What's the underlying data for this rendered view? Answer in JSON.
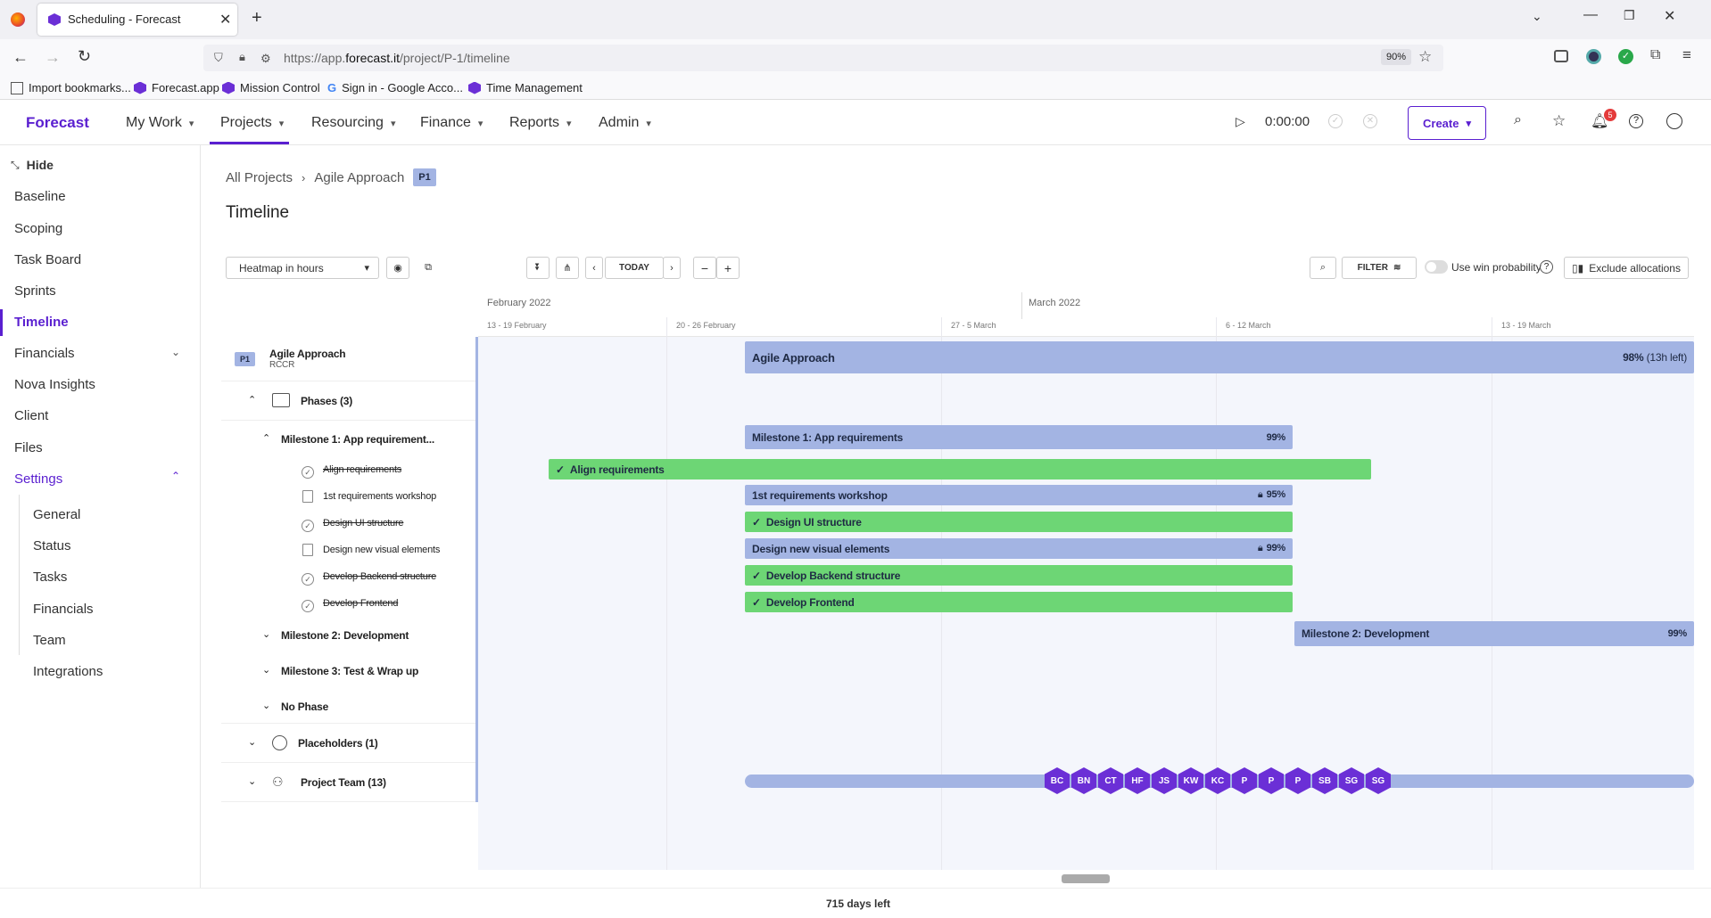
{
  "browser": {
    "tab_title": "Scheduling - Forecast",
    "url_prefix": "https://app.",
    "url_domain": "forecast.it",
    "url_path": "/project/P-1/timeline",
    "zoom": "90%",
    "bookmarks": [
      "Import bookmarks...",
      "Forecast.app",
      "Mission Control",
      "Sign in - Google Acco...",
      "Time Management"
    ]
  },
  "appnav": {
    "logo": "Forecast",
    "items": [
      "My Work",
      "Projects",
      "Resourcing",
      "Finance",
      "Reports",
      "Admin"
    ],
    "timer": "0:00:00",
    "create_label": "Create",
    "notification_count": "5",
    "colors": {
      "brand": "#6b2fd6",
      "active": "#5a1fd0"
    }
  },
  "sidebar": {
    "hide_label": "Hide",
    "items": [
      "Baseline",
      "Scoping",
      "Task Board",
      "Sprints",
      "Timeline",
      "Financials",
      "Nova Insights",
      "Client",
      "Files",
      "Settings"
    ],
    "settings_sub": [
      "General",
      "Status",
      "Tasks",
      "Financials",
      "Team",
      "Integrations"
    ]
  },
  "breadcrumb": {
    "all_projects": "All Projects",
    "project": "Agile Approach",
    "badge": "P1"
  },
  "page_title": "Timeline",
  "toolbar": {
    "heatmap_select": "Heatmap in hours",
    "today": "TODAY",
    "filter": "FILTER",
    "win_probability": "Use win probability",
    "exclude_allocations": "Exclude allocations"
  },
  "timeline": {
    "months": [
      "February 2022",
      "March 2022"
    ],
    "weeks": [
      "13 - 19 February",
      "20 - 26 February",
      "27 - 5 March",
      "6 - 12 March",
      "13 - 19 March"
    ]
  },
  "rows": {
    "project_badge": "P1",
    "project_name": "Agile Approach",
    "project_client": "RCCR",
    "phases": "Phases (3)",
    "milestone1": "Milestone 1: App requirement...",
    "tasks": [
      "Align requirements",
      "1st requirements workshop",
      "Design UI structure",
      "Design new visual elements",
      "Develop Backend structure",
      "Develop Frontend"
    ],
    "milestone2": "Milestone 2: Development",
    "milestone3": "Milestone 3: Test & Wrap up",
    "no_phase": "No Phase",
    "placeholders": "Placeholders (1)",
    "project_team": "Project Team (13)"
  },
  "bars": {
    "project": {
      "label": "Agile Approach",
      "pct": "98%",
      "left": "(13h left)"
    },
    "milestone1": {
      "label": "Milestone 1: App requirements",
      "pct": "99%"
    },
    "align": {
      "label": "Align requirements"
    },
    "workshop": {
      "label": "1st requirements workshop",
      "pct": "95%"
    },
    "design_ui": {
      "label": "Design UI structure"
    },
    "visual": {
      "label": "Design new visual elements",
      "pct": "99%"
    },
    "backend": {
      "label": "Develop Backend structure"
    },
    "frontend": {
      "label": "Develop Frontend"
    },
    "milestone2": {
      "label": "Milestone 2: Development",
      "pct": "99%"
    }
  },
  "team_avatars": [
    "BC",
    "BN",
    "CT",
    "HF",
    "JS",
    "KW",
    "KC",
    "P",
    "P",
    "P",
    "SB",
    "SG",
    "SG"
  ],
  "footer": "715 days left"
}
